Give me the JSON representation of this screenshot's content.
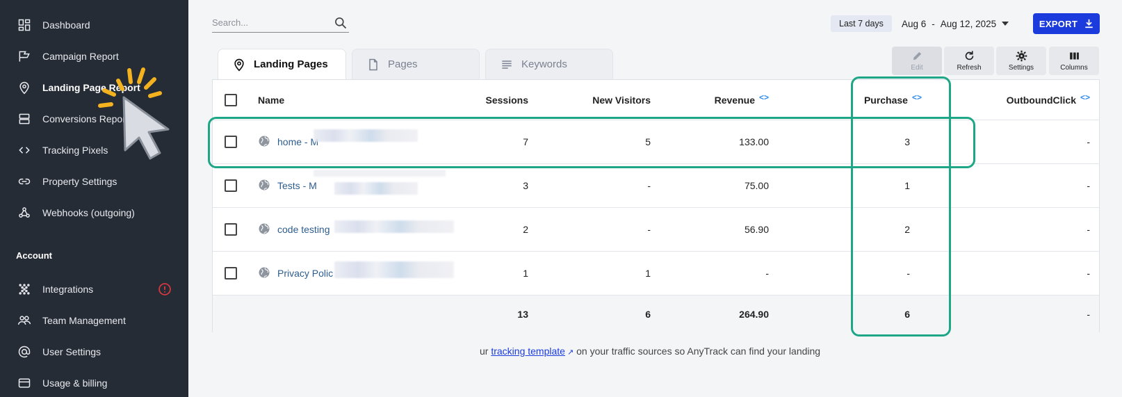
{
  "sidebar": {
    "items": [
      {
        "label": "Dashboard",
        "icon": "dashboard-icon"
      },
      {
        "label": "Campaign Report",
        "icon": "flag-icon"
      },
      {
        "label": "Landing Page Report",
        "icon": "location-pin-icon"
      },
      {
        "label": "Conversions Repor",
        "icon": "layers-icon"
      },
      {
        "label": "Tracking Pixels",
        "icon": "code-icon"
      },
      {
        "label": "Property Settings",
        "icon": "link-icon"
      },
      {
        "label": "Webhooks (outgoing)",
        "icon": "webhook-icon"
      }
    ],
    "section_label": "Account",
    "account_items": [
      {
        "label": "Integrations",
        "icon": "integrations-icon"
      },
      {
        "label": "Team Management",
        "icon": "team-icon"
      },
      {
        "label": "User Settings",
        "icon": "at-icon"
      },
      {
        "label": "Usage & billing",
        "icon": "credit-card-icon"
      }
    ]
  },
  "search": {
    "placeholder": "Search..."
  },
  "date_filter": {
    "preset": "Last 7 days",
    "start": "Aug 6",
    "separator": "-",
    "end": "Aug 12, 2025"
  },
  "export_label": "EXPORT",
  "tabs": [
    {
      "label": "Landing Pages",
      "active": true
    },
    {
      "label": "Pages",
      "active": false
    },
    {
      "label": "Keywords",
      "active": false
    }
  ],
  "toolbar": {
    "edit": "Edit",
    "refresh": "Refresh",
    "settings": "Settings",
    "columns": "Columns"
  },
  "table": {
    "columns": [
      "Name",
      "Sessions",
      "New Visitors",
      "Revenue",
      "Purchase",
      "OutboundClick"
    ],
    "rows": [
      {
        "name": "home - M",
        "sessions": "7",
        "new_visitors": "5",
        "revenue": "133.00",
        "purchase": "3",
        "outbound": "-"
      },
      {
        "name": "Tests - M",
        "sessions": "3",
        "new_visitors": "-",
        "revenue": "75.00",
        "purchase": "1",
        "outbound": "-"
      },
      {
        "name": "code testing",
        "sessions": "2",
        "new_visitors": "-",
        "revenue": "56.90",
        "purchase": "2",
        "outbound": "-"
      },
      {
        "name": "Privacy Polic",
        "sessions": "1",
        "new_visitors": "1",
        "revenue": "-",
        "purchase": "-",
        "outbound": "-"
      }
    ],
    "totals": {
      "sessions": "13",
      "new_visitors": "6",
      "revenue": "264.90",
      "purchase": "6",
      "outbound": "-"
    }
  },
  "footnote": {
    "before": "ur ",
    "link": "tracking template",
    "after": " on your traffic sources so AnyTrack can find your landing"
  },
  "colors": {
    "sidebar_bg": "#262c36",
    "accent": "#1b3bdc",
    "highlight": "#1ea787",
    "cursor_burst": "#f4b21f"
  }
}
